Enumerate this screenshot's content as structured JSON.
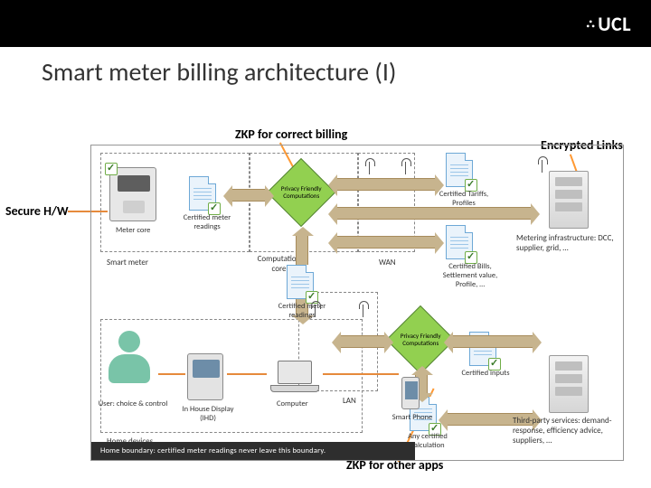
{
  "brand": {
    "logo_text": "UCL",
    "portico": "⛬"
  },
  "title": "Smart meter billing architecture (I)",
  "annotations": {
    "zkp_billing": "ZKP for correct billing",
    "encrypted_links": "Encrypted Links",
    "secure_hw": "Secure H/W",
    "zkp_other": "ZKP for other apps"
  },
  "zones": {
    "smart_meter": "Smart meter",
    "meter_core": "Meter core",
    "comp_core": "Computation core",
    "wan": "WAN",
    "lan": "LAN",
    "home_devices": "Home devices"
  },
  "diamonds": {
    "pfc": "Privacy Friendly Computations"
  },
  "docs": {
    "meter_readings": "Certified meter readings",
    "tariffs": "Certified Tariffs, Profiles",
    "bills": "Certified Bills, Settlement value, Profile, …",
    "cert_meter2": "Certified meter readings",
    "cert_inputs": "Certified inputs",
    "any_calc": "Any certified calculation"
  },
  "devices": {
    "user": "User: choice & control",
    "ihd": "In House Display (IHD)",
    "computer": "Computer",
    "phone": "Smart Phone",
    "metering_infra": "Metering infrastructure: DCC, supplier, grid, …",
    "third_party": "Third-party services: demand-response, efficiency advice, suppliers, …"
  },
  "footer": "Home boundary: certified meter readings never leave this boundary."
}
